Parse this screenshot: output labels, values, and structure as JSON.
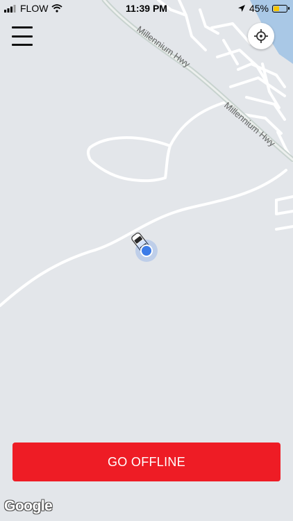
{
  "status_bar": {
    "carrier": "FLOW",
    "time": "11:39 PM",
    "battery_percent": "45%",
    "battery_level": 0.45,
    "icons": [
      "signal-icon",
      "wifi-icon",
      "location-arrow-icon",
      "battery-icon"
    ]
  },
  "header": {
    "menu_icon": "hamburger-menu-icon",
    "locate_icon": "crosshair-icon"
  },
  "map": {
    "road_labels": [
      "Millennium Hwy",
      "Millennium Hwy"
    ],
    "provider": "Google",
    "colors": {
      "land": "#e3e6ea",
      "road": "#ffffff",
      "highway": "#c8d3cf",
      "water": "#a9c8e6",
      "location_dot": "#3d7ce8"
    }
  },
  "action": {
    "go_offline_label": "GO OFFLINE",
    "color": "#ee1c25"
  }
}
